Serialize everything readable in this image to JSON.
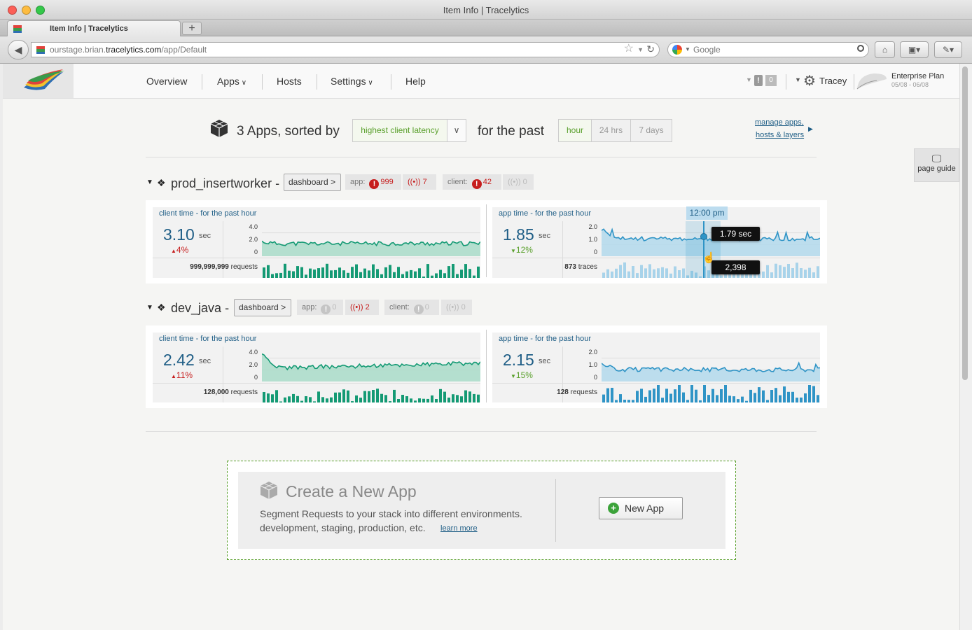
{
  "window": {
    "title": "Item Info | Tracelytics"
  },
  "tab": {
    "label": "Item Info | Tracelytics",
    "new_tab": "+"
  },
  "navbar": {
    "url_host_prefix": "ourstage.brian.",
    "url_host_domain": "tracelytics.com",
    "url_path": "/app/Default",
    "search_placeholder": "Google"
  },
  "menu": {
    "overview": "Overview",
    "apps": "Apps",
    "hosts": "Hosts",
    "settings": "Settings",
    "help": "Help"
  },
  "user": {
    "alert_count": "0",
    "name": "Tracey",
    "plan": "Enterprise Plan",
    "plan_dates": "05/08 - 06/08"
  },
  "page_guide": "page guide",
  "sorting": {
    "count_text": "3 Apps, sorted by",
    "sort_value": "highest client latency",
    "for_the_past": "for the past",
    "ranges": [
      "hour",
      "24 hrs",
      "7 days"
    ],
    "selected_range": "hour",
    "manage_line1": "manage apps,",
    "manage_line2": "hosts & layers"
  },
  "apps": [
    {
      "name": "prod_insertworker",
      "dash": "dashboard",
      "dash_chevron": ">",
      "app_label": "app:",
      "app_errors": "999",
      "app_signal": "7",
      "client_label": "client:",
      "client_errors": "42",
      "client_signal": "0",
      "client": {
        "title": "client time - for the past hour",
        "value": "3.10",
        "unit": "sec",
        "delta": "4%",
        "delta_dir": "up",
        "ticks": [
          "4.0",
          "2.0",
          "0"
        ],
        "count": "999,999,999",
        "count_label": "requests"
      },
      "apptime": {
        "title": "app time - for the past hour",
        "value": "1.85",
        "unit": "sec",
        "delta": "12%",
        "delta_dir": "down",
        "ticks": [
          "2.0",
          "1.0",
          "0"
        ],
        "count": "873",
        "count_label": "traces",
        "hover_time": "12:00 pm",
        "hover_value": "1.79 sec",
        "hover_count": "2,398"
      }
    },
    {
      "name": "dev_java",
      "dash": "dashboard",
      "dash_chevron": ">",
      "app_label": "app:",
      "app_errors": "0",
      "app_signal": "2",
      "client_label": "client:",
      "client_errors": "0",
      "client_signal": "0",
      "client": {
        "title": "client time - for the past hour",
        "value": "2.42",
        "unit": "sec",
        "delta": "11%",
        "delta_dir": "up",
        "ticks": [
          "4.0",
          "2.0",
          "0"
        ],
        "count": "128,000",
        "count_label": "requests"
      },
      "apptime": {
        "title": "app time - for the past hour",
        "value": "2.15",
        "unit": "sec",
        "delta": "15%",
        "delta_dir": "down",
        "ticks": [
          "2.0",
          "1.0",
          "0"
        ],
        "count": "128",
        "count_label": "requests"
      }
    }
  ],
  "create": {
    "title": "Create a New App",
    "line1": "Segment Requests to your stack into different environments.",
    "line2": "development, staging, production, etc.",
    "learn_more": "learn more",
    "button": "New App"
  },
  "colors": {
    "client_line": "#149a74",
    "client_fill": "#a9dcc9",
    "app_line": "#2f94c6",
    "app_fill": "#b3d9ec",
    "error_red": "#c61d1d",
    "accent_green": "#5aa02c"
  }
}
